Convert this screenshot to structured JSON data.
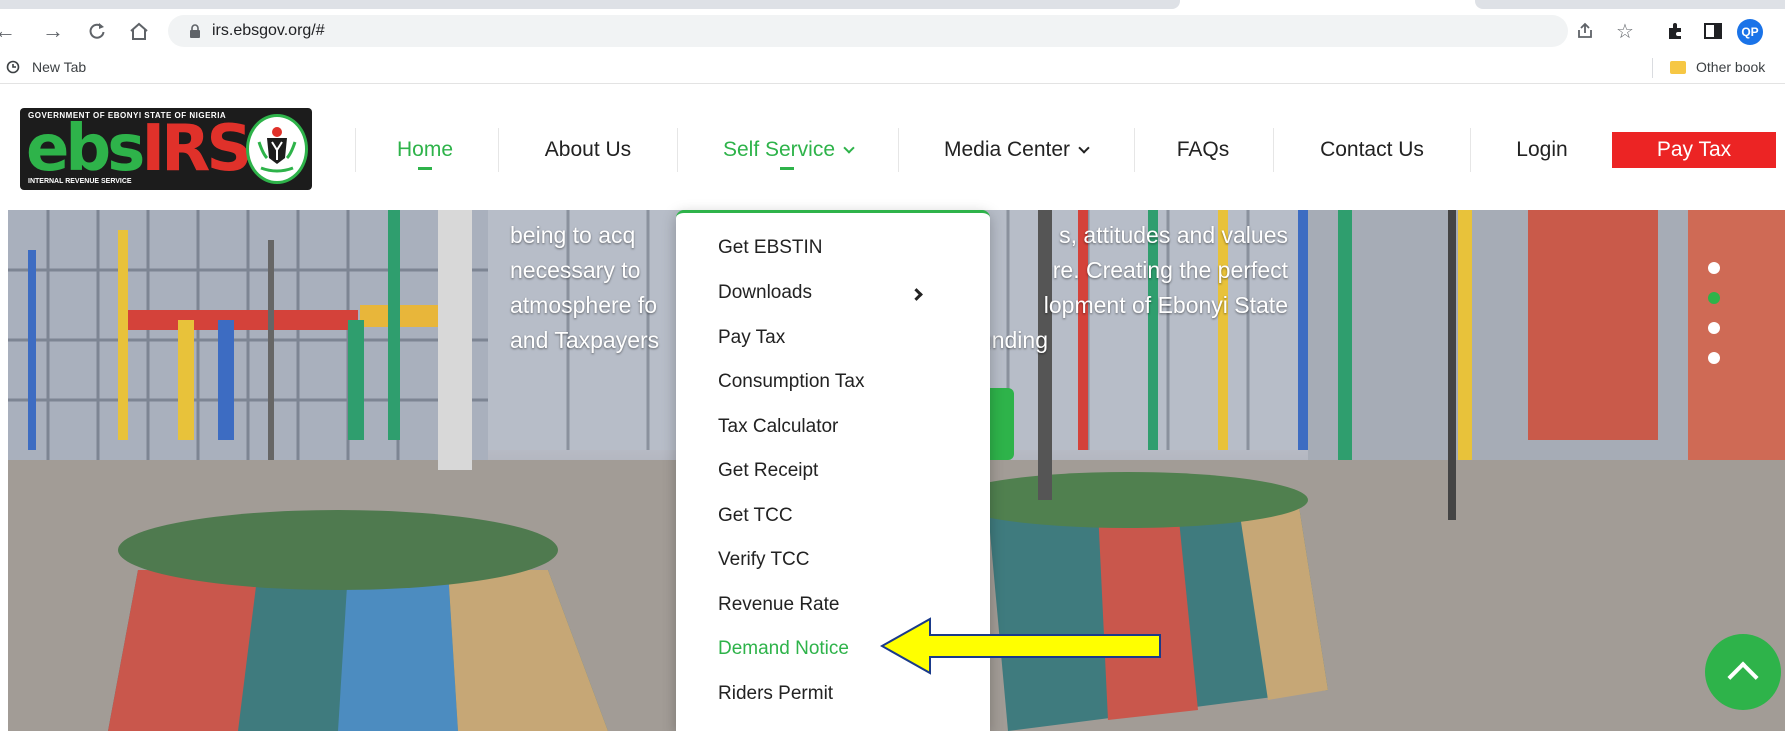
{
  "browser": {
    "url": "irs.ebsgov.org/#",
    "bookmarks": {
      "new_tab": "New Tab",
      "other_bookmarks": "Other book"
    },
    "profile_initials": "QP"
  },
  "site": {
    "logo": {
      "top_text": "GOVERNMENT OF EBONYI STATE OF NIGERIA",
      "wordmark_green": "ebs",
      "wordmark_red": "IRS",
      "bottom_text": "INTERNAL REVENUE SERVICE"
    },
    "nav": {
      "home": "Home",
      "about": "About Us",
      "self_service": "Self Service",
      "media_center": "Media Center",
      "faqs": "FAQs",
      "contact": "Contact Us",
      "login": "Login",
      "pay_tax": "Pay Tax"
    },
    "colors": {
      "brand_green": "#2eb34a",
      "pay_red": "#ec2424",
      "arrow_yellow": "#ffff00"
    }
  },
  "hero": {
    "lines": [
      "being to acq",
      "s, attitudes and values",
      "necessary to",
      "re. Creating the perfect",
      "atmosphere fo",
      "lopment of Ebonyi State",
      "and Taxpayers",
      "sely to the funding"
    ]
  },
  "dropdown": {
    "items": [
      "Get EBSTIN",
      "Downloads",
      "Pay Tax",
      "Consumption Tax",
      "Tax Calculator",
      "Get Receipt",
      "Get TCC",
      "Verify TCC",
      "Revenue Rate",
      "Demand Notice",
      "Riders Permit"
    ],
    "highlighted": "Demand Notice"
  }
}
